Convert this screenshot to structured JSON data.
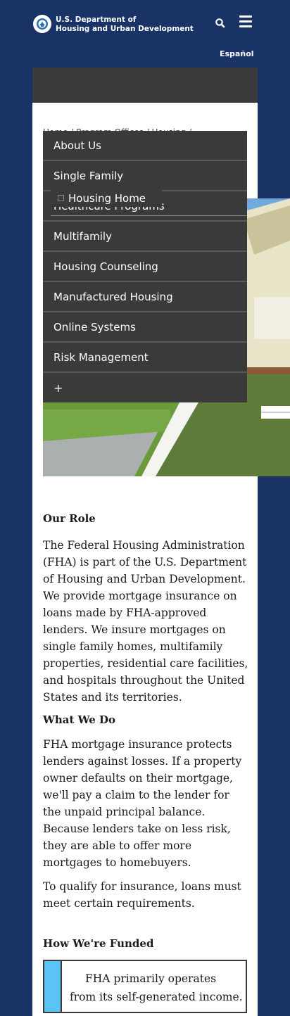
{
  "header": {
    "agency_line1": "U.S. Department of",
    "agency_line2": "Housing and Urban Development",
    "language_link": "Español"
  },
  "icons": {
    "seal": "hud-seal-icon",
    "search": "search-icon",
    "menu": "hamburger-menu-icon"
  },
  "breadcrumb_partial": "Home / Program Offices / Housing / ...",
  "menu": {
    "items": [
      {
        "label": "About Us"
      },
      {
        "label": "Single Family"
      },
      {
        "label": "Healthcare Programs"
      },
      {
        "label": "Multifamily"
      },
      {
        "label": "Housing Counseling"
      },
      {
        "label": "Manufactured Housing"
      },
      {
        "label": "Online Systems"
      },
      {
        "label": "Risk Management"
      },
      {
        "label": "+"
      }
    ],
    "housing_home_label": "Housing Home"
  },
  "content": {
    "our_role_heading": "Our Role",
    "our_role_text": "The Federal Housing Administration (FHA) is part of the U.S. Department of Housing and Urban Development. We provide mortgage insurance on loans made by FHA-approved lenders. We insure mortgages on single family homes, multifamily properties, residential care facilities, and hospitals throughout the United States and its territories.",
    "what_we_do_heading": "What We Do",
    "what_we_do_text": "FHA mortgage insurance protects lenders against losses. If a property owner defaults on their mortgage, we'll pay a claim to the lender for the unpaid principal balance. Because lenders take on less risk, they are able to offer more mortgages to homebuyers.",
    "qualify_text": "To qualify for insurance, loans must meet certain requirements.",
    "funded_heading": "How We're Funded",
    "callout_text": "FHA primarily operates from its self-generated income."
  },
  "colors": {
    "background": "#1a3366",
    "menu_bg": "#3a3a3a",
    "callout_accent": "#5bc4f5"
  }
}
